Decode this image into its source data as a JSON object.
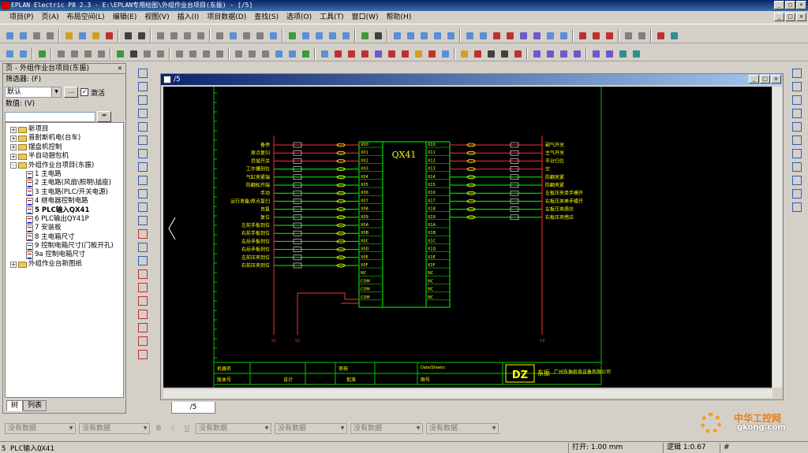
{
  "window": {
    "title": "EPLAN Electric P8 2.3 - E:\\EPLAN专用绘图\\外组作业台项目(东振) - [/5]",
    "min": "_",
    "max": "□",
    "close": "×"
  },
  "menu": [
    "项目(P)",
    "页(A)",
    "布局空间(L)",
    "编辑(E)",
    "视图(V)",
    "插入(I)",
    "项目数据(D)",
    "查找(S)",
    "选项(O)",
    "工具(T)",
    "窗口(W)",
    "帮助(H)"
  ],
  "left_panel": {
    "title": "页 - 外组作业台项目(东振)",
    "close": "×",
    "filter_label": "筛选器: (F)",
    "filter_value": "默认",
    "filter_btn": "...",
    "activate_check": "✓",
    "activate_label": "激活",
    "value_label": "数值: (V)",
    "tree": [
      {
        "level": 0,
        "type": "folder",
        "expander": "+",
        "label": "新项目"
      },
      {
        "level": 0,
        "type": "folder",
        "expander": "+",
        "label": "普耐斯机电(台车)"
      },
      {
        "level": 0,
        "type": "folder",
        "expander": "+",
        "label": "摆盘机控制"
      },
      {
        "level": 0,
        "type": "folder",
        "expander": "+",
        "label": "半自动捆包机"
      },
      {
        "level": 0,
        "type": "folder",
        "expander": "-",
        "label": "外组作业台项目(东振)"
      },
      {
        "level": 1,
        "type": "page",
        "label": "1 主电路"
      },
      {
        "level": 1,
        "type": "page",
        "label": "2 主电路(风扇\\照明\\插座)"
      },
      {
        "level": 1,
        "type": "page",
        "label": "3 主电路(PLC/开关电源)"
      },
      {
        "level": 1,
        "type": "page",
        "label": "4 继电器控制电路"
      },
      {
        "level": 1,
        "type": "page",
        "label": "5 PLC输入QX41",
        "selected": true
      },
      {
        "level": 1,
        "type": "page",
        "label": "6 PLC输出QY41P"
      },
      {
        "level": 1,
        "type": "page",
        "label": "7 安装板"
      },
      {
        "level": 1,
        "type": "page",
        "label": "8 主电箱尺寸"
      },
      {
        "level": 1,
        "type": "page",
        "label": "9 控制电箱尺寸(门板开孔)"
      },
      {
        "level": 1,
        "type": "page",
        "label": "9a 控制电箱尺寸"
      },
      {
        "level": 0,
        "type": "folder",
        "expander": "+",
        "label": "外组作业台新图纸"
      }
    ],
    "tabs": [
      "树",
      "列表"
    ]
  },
  "document": {
    "title": "/5",
    "tab": "/5"
  },
  "schematic": {
    "module": "QX41",
    "left_labels": [
      "备停",
      "原点复归",
      "异常开关",
      "工作槽到位",
      "气缸夹紧端",
      "防翻松开端",
      "手动",
      "运行准备/原点复归",
      "自复",
      "复位",
      "左前手板到位",
      "右前手板到位",
      "左后手板到位",
      "右后手板到位",
      "左前压夹到位",
      "右前压夹到位"
    ],
    "right_labels": [
      "副气开关",
      "主气开关",
      "平台归位",
      "空",
      "防翻夹紧",
      "防翻夹紧",
      "左板压夹单手模开",
      "右板压夹单手模开",
      "左板压夹感应",
      "右板压夹感应"
    ],
    "left_pins": [
      "X00",
      "X01",
      "X02",
      "X03",
      "X04",
      "X05",
      "X06",
      "X07",
      "X08",
      "X09",
      "X0A",
      "X0B",
      "X0C",
      "X0D",
      "X0E",
      "X0F",
      "NC",
      "COM",
      "COM",
      "COM"
    ],
    "right_pins": [
      "X10",
      "X11",
      "X12",
      "X13",
      "X14",
      "X15",
      "X16",
      "X17",
      "X18",
      "X19",
      "X1A",
      "X1B",
      "X1C",
      "X1D",
      "X1E",
      "X1F",
      "NC",
      "NC",
      "NC",
      "NC"
    ],
    "title_block": {
      "company": "广州东振机电设备有限公司",
      "brand": "东振",
      "logo": "DZ",
      "fields": [
        "机器名",
        "设计",
        "审核",
        "批准",
        "图号",
        "版本号",
        "Date/Sheets"
      ]
    }
  },
  "property_bar": {
    "combo1": "没有数据",
    "combo2": "没有数据",
    "fmt": [
      "B",
      "I",
      "U"
    ],
    "combo3": "没有数据",
    "combo4": "没有数据",
    "combo5": "没有数据",
    "combo6": "没有数据"
  },
  "status": {
    "left": "5 PLC输入QX41",
    "open": "打开: 1.00 mm",
    "logic": "逻辑 1:0.67",
    "hash": "#"
  },
  "watermark": {
    "line1": "中华工控网",
    "line2": "gkong.com"
  },
  "colors": {
    "titlebar": "#0a246a",
    "canvas_bg": "#000000",
    "wire_green": "#00ff00",
    "wire_red": "#ff3030",
    "label_yellow": "#ffff00"
  }
}
